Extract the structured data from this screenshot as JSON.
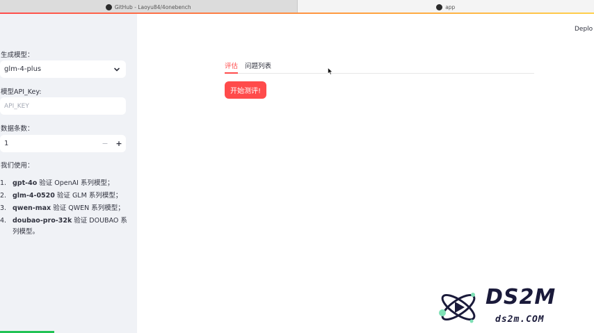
{
  "browser": {
    "tabs": [
      {
        "label": "GitHub - Laoyu84/4onebench",
        "icon": "github-icon"
      },
      {
        "label": "app",
        "icon": "streamlit-icon"
      }
    ]
  },
  "sidebar": {
    "model_label": "生成模型：",
    "model_value": "glm-4-plus",
    "api_key_label": "模型API_Key:",
    "api_key_placeholder": "API_KEY",
    "count_label": "数据条数：",
    "count_value": "1",
    "count_minus": "−",
    "count_plus": "+",
    "usage_title": "我们使用：",
    "models": [
      {
        "index": "1.",
        "name": "gpt-4o",
        "desc": " 验证 OpenAI 系列模型；"
      },
      {
        "index": "2.",
        "name": "glm-4-0520",
        "desc": " 验证 GLM 系列模型；"
      },
      {
        "index": "3.",
        "name": "qwen-max",
        "desc": " 验证 QWEN 系列模型；"
      },
      {
        "index": "4.",
        "name": "doubao-pro-32k",
        "desc": " 验证 DOUBAO 系列模型。"
      }
    ]
  },
  "main": {
    "deploy_label": "Deplo",
    "tabs": [
      {
        "label": "评估",
        "active": true
      },
      {
        "label": "问题列表",
        "active": false
      }
    ],
    "start_button": "开始测评!"
  },
  "watermark": {
    "big": "DS2M",
    "small": "ds2m.COM"
  },
  "colors": {
    "accent": "#ff4b4b",
    "sidebar_bg": "#f0f2f6",
    "progress": "#21c354"
  }
}
